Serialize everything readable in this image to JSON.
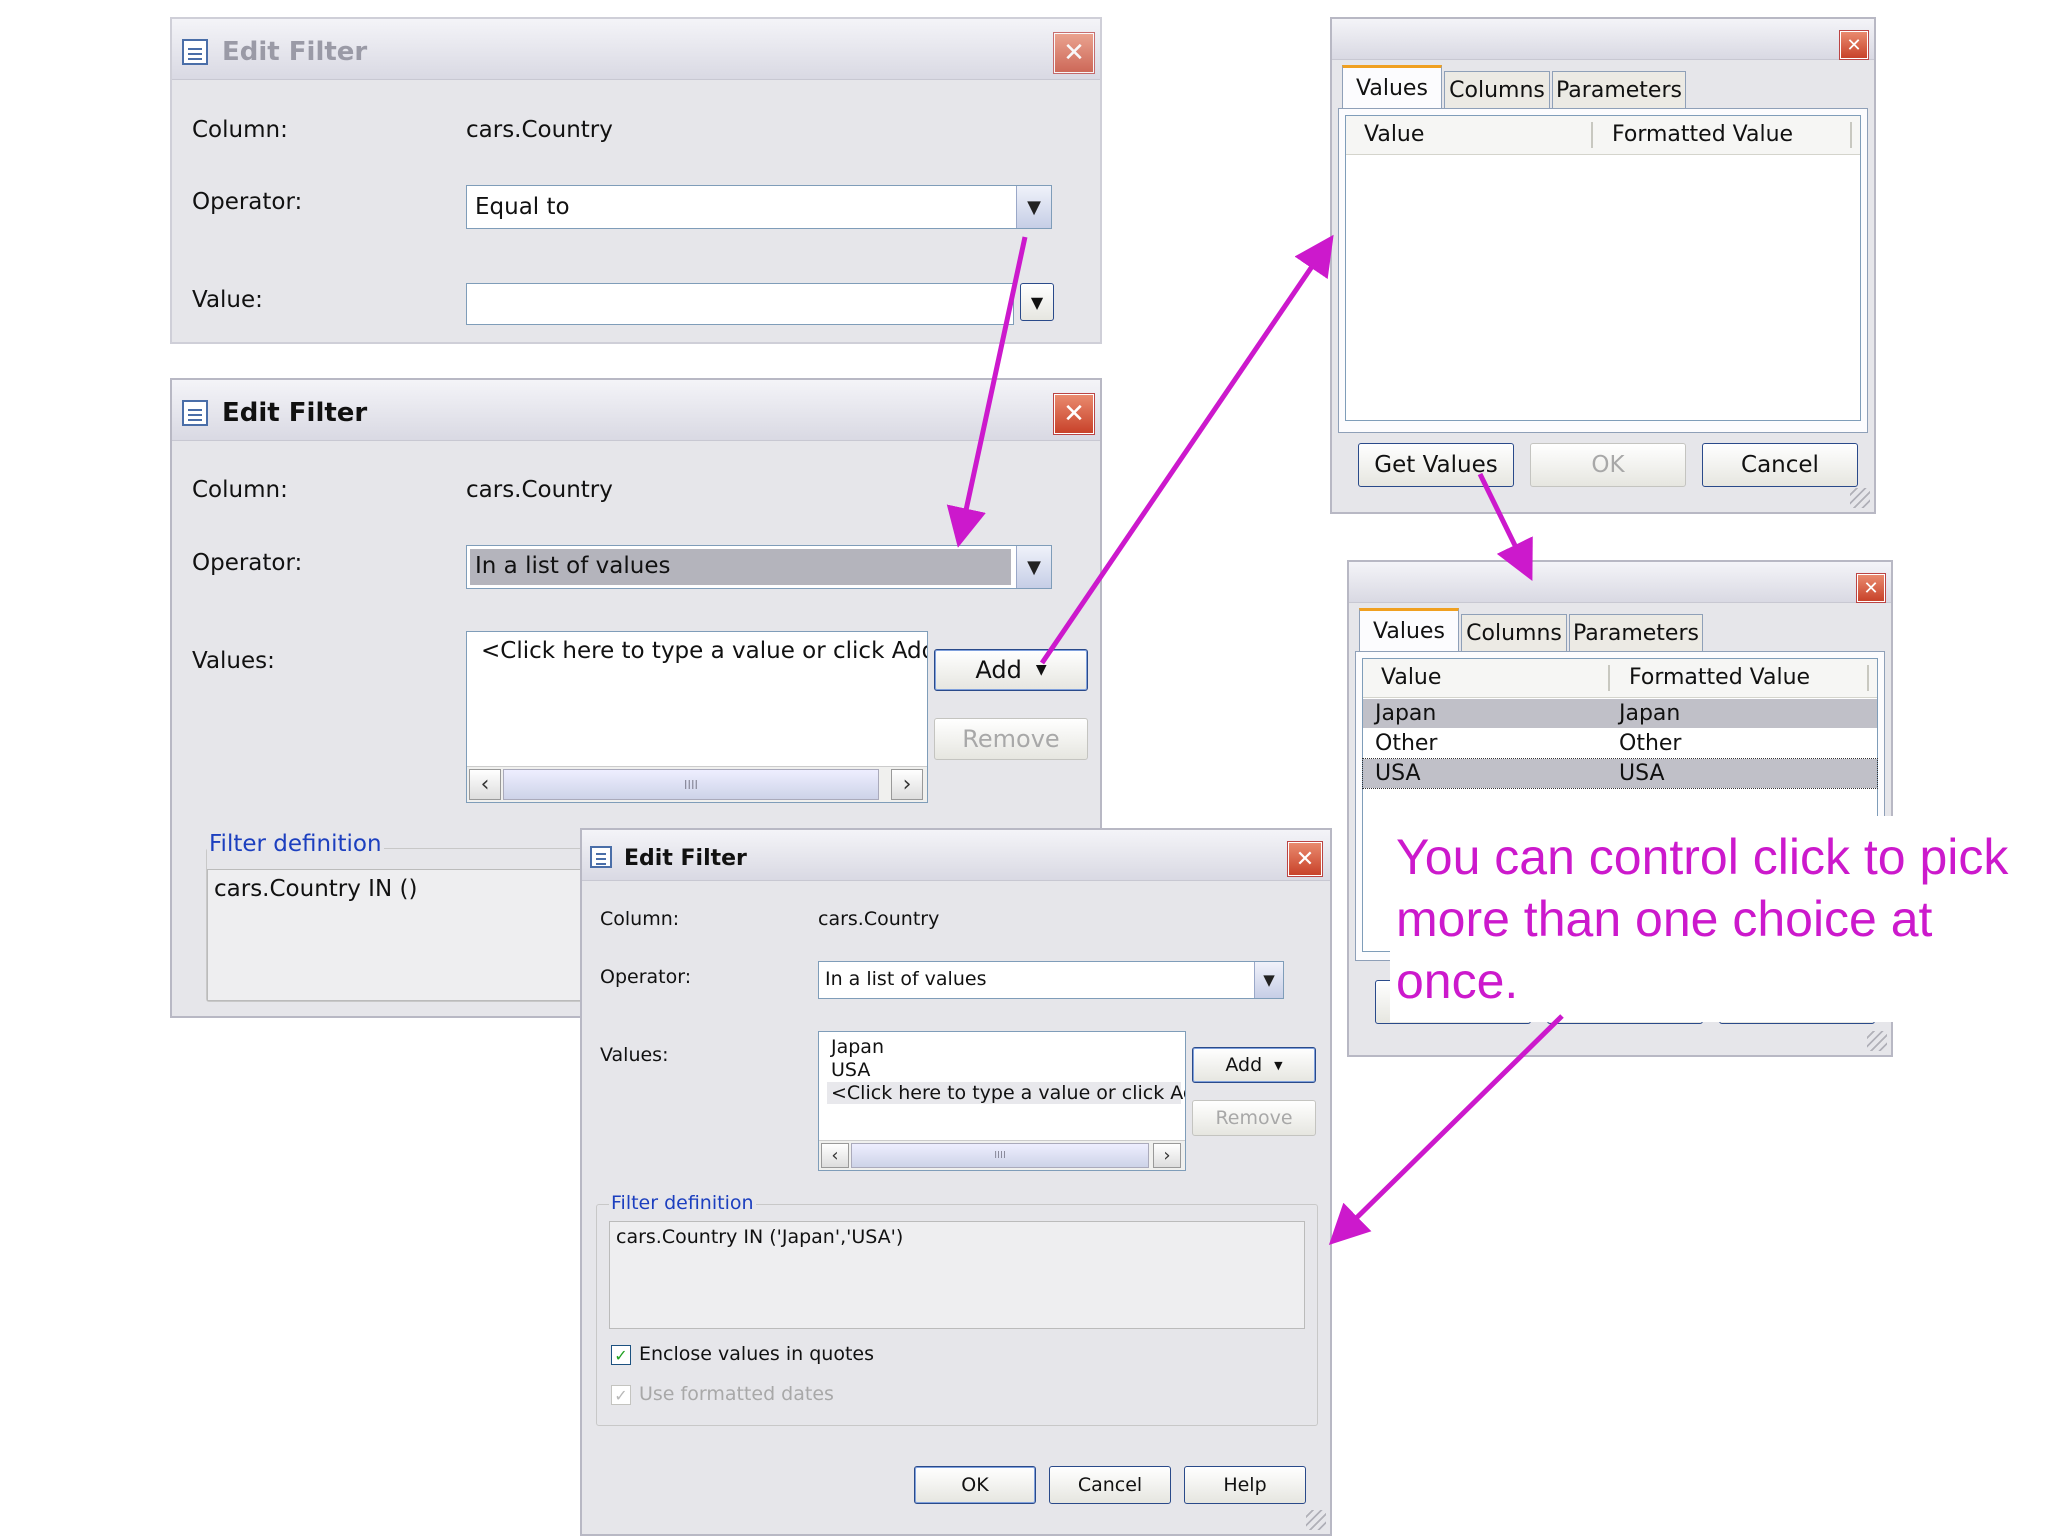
{
  "colors": {
    "accent_arrow": "#cc19cc",
    "title_gradient": "#d9d9e3",
    "link_blue": "#1c3fbf",
    "close_red": "#c8422a"
  },
  "dialog1": {
    "title": "Edit Filter",
    "column_label": "Column:",
    "column_value": "cars.Country",
    "operator_label": "Operator:",
    "operator_value": "Equal to",
    "value_label": "Value:",
    "value_value": ""
  },
  "dialog2": {
    "title": "Edit Filter",
    "column_label": "Column:",
    "column_value": "cars.Country",
    "operator_label": "Operator:",
    "operator_value": "In a list of values",
    "values_label": "Values:",
    "values_placeholder": "<Click here to type a value or click Add>",
    "add_label": "Add",
    "remove_label": "Remove",
    "filter_def_label": "Filter definition",
    "filter_def_value": "cars.Country IN ()",
    "scroll_thumb": "IIII"
  },
  "dialog3": {
    "title": "Edit Filter",
    "column_label": "Column:",
    "column_value": "cars.Country",
    "operator_label": "Operator:",
    "operator_value": "In a list of values",
    "values_label": "Values:",
    "values_list": [
      "Japan",
      "USA",
      "<Click here to type a value or click Add>"
    ],
    "add_label": "Add",
    "remove_label": "Remove",
    "filter_def_label": "Filter definition",
    "filter_def_value": "cars.Country IN ('Japan','USA')",
    "enclose_label": "Enclose values in quotes",
    "enclose_checked": true,
    "formatted_dates_label": "Use formatted dates",
    "formatted_dates_checked": true,
    "ok_label": "OK",
    "cancel_label": "Cancel",
    "help_label": "Help",
    "scroll_thumb": "IIII"
  },
  "picker1": {
    "tabs": [
      "Values",
      "Columns",
      "Parameters"
    ],
    "col_value": "Value",
    "col_formatted": "Formatted Value",
    "get_values_label": "Get Values",
    "ok_label": "OK",
    "cancel_label": "Cancel"
  },
  "picker2": {
    "tabs": [
      "Values",
      "Columns",
      "Parameters"
    ],
    "col_value": "Value",
    "col_formatted": "Formatted Value",
    "rows": [
      {
        "value": "Japan",
        "formatted": "Japan",
        "selected": true
      },
      {
        "value": "Other",
        "formatted": "Other",
        "selected": false
      },
      {
        "value": "USA",
        "formatted": "USA",
        "selected": true
      }
    ]
  },
  "annotation": "You can control click to pick\nmore than one choice at\nonce."
}
